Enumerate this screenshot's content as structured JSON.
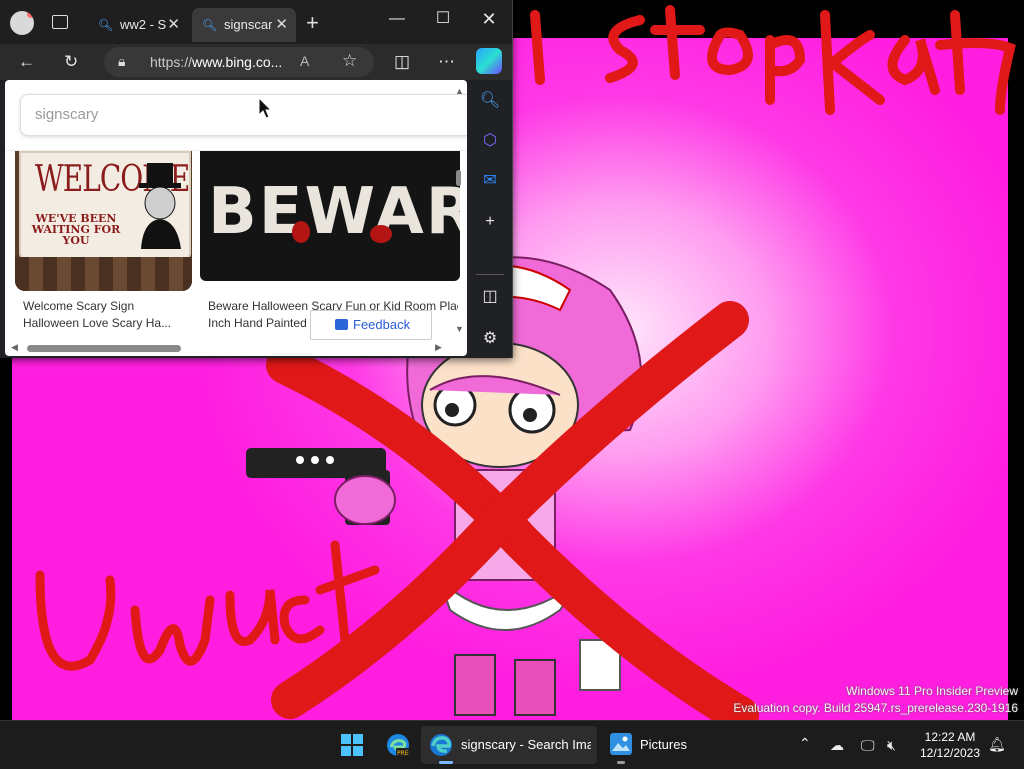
{
  "browser": {
    "tabs": [
      {
        "label": "ww2 - S",
        "active": false
      },
      {
        "label": "signscar",
        "active": true
      }
    ],
    "window_buttons": {
      "minimize": "—",
      "maximize": "☐",
      "close": "✕"
    },
    "address": {
      "prefix": "https://",
      "host": "www.bing.co..."
    },
    "read_aloud": "A",
    "search_query": "signscary",
    "results": [
      {
        "image_title": "WELCOME",
        "image_subtitle": "WE'VE BEEN WAITING FOR YOU",
        "caption_line1": "Welcome Scary Sign",
        "caption_line2": "Halloween Love Scary Ha..."
      },
      {
        "image_title": "BEWAR",
        "caption_line1": "Beware Halloween Scary Fun or Kid Room Plac",
        "caption_line2": "Inch Hand Painted"
      }
    ],
    "feedback_label": "Feedback"
  },
  "wallpaper": {
    "scribble_top": "l stop kat",
    "scribble_bottom": "Uwu ct"
  },
  "watermark": {
    "line1": "Windows 11 Pro Insider Preview",
    "line2": "Evaluation copy. Build 25947.rs_prerelease.230-1916"
  },
  "taskbar": {
    "apps": [
      {
        "name": "Edge Preview",
        "label": ""
      },
      {
        "name": "Edge",
        "label": "signscary - Search Imag"
      },
      {
        "name": "Pictures",
        "label": "Pictures"
      }
    ],
    "pre_badge": "PRE",
    "time": "12:22 AM",
    "date": "12/12/2023"
  },
  "colors": {
    "accent": "#4aa3ff",
    "wallpaper_pink": "#ff38e6",
    "scribble_red": "#e01818"
  }
}
